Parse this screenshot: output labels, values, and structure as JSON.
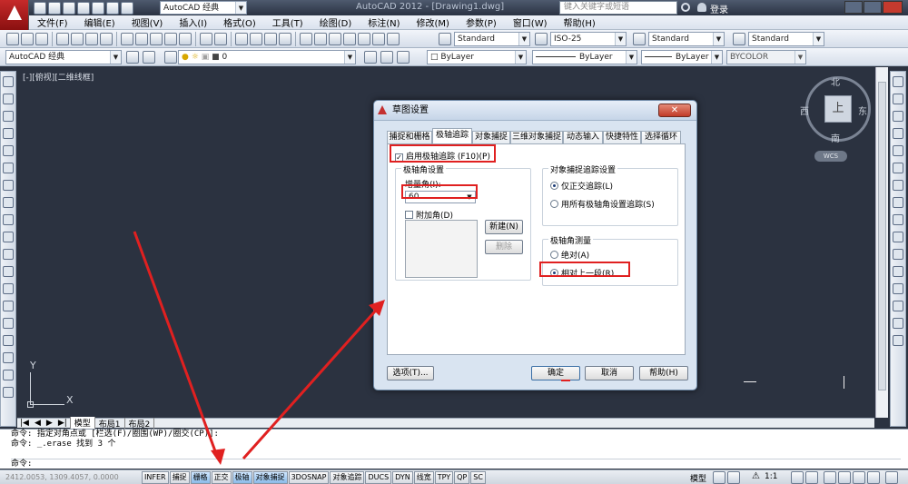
{
  "app": {
    "title": "AutoCAD 2012 - [Drawing1.dwg]",
    "workspace": "AutoCAD 经典",
    "search_placeholder": "键入关键字或短语",
    "login": "登录"
  },
  "menu": [
    "文件(F)",
    "编辑(E)",
    "视图(V)",
    "插入(I)",
    "格式(O)",
    "工具(T)",
    "绘图(D)",
    "标注(N)",
    "修改(M)",
    "参数(P)",
    "窗口(W)",
    "帮助(H)"
  ],
  "styles": {
    "text_style": "Standard",
    "dim_style": "ISO-25",
    "table_style": "Standard",
    "mleader_style": "Standard"
  },
  "layers": {
    "workspace": "AutoCAD 经典",
    "layer_name": "0",
    "color": "ByLayer",
    "linetype": "ByLayer",
    "lineweight": "ByLayer",
    "plotstyle": "BYCOLOR"
  },
  "viewport_label": "[-][俯视][二维线框]",
  "viewcube": {
    "north": "北",
    "south": "南",
    "east": "东",
    "west": "西",
    "top": "上",
    "wcs": "WCS"
  },
  "ucs": {
    "x": "X",
    "y": "Y"
  },
  "layout_tabs": [
    "模型",
    "布局1",
    "布局2"
  ],
  "command": {
    "line1": "命令: 指定对角点或 [栏选(F)/圈围(WP)/圈交(CP)]:",
    "line2": "命令: _.erase 找到 3 个",
    "prompt": "命令:"
  },
  "status": {
    "coords": "2412.0053, 1309.4057, 0.0000",
    "toggles": [
      "INFER",
      "捕捉",
      "栅格",
      "正交",
      "极轴",
      "对象捕捉",
      "3DOSNAP",
      "对象追踪",
      "DUCS",
      "DYN",
      "线宽",
      "TPY",
      "QP",
      "SC"
    ],
    "active": [
      "栅格",
      "极轴",
      "对象捕捉"
    ],
    "model": "模型",
    "scale": "1:1"
  },
  "dialog": {
    "title": "草图设置",
    "tabs": [
      "捕捉和栅格",
      "极轴追踪",
      "对象捕捉",
      "三维对象捕捉",
      "动态输入",
      "快捷特性",
      "选择循环"
    ],
    "active_tab": "极轴追踪",
    "enable_polar": "启用极轴追踪 (F10)(P)",
    "polar_group": "极轴角设置",
    "increment_label": "增量角(I):",
    "increment_value": "60",
    "additional_label": "附加角(D)",
    "new_button": "新建(N)",
    "delete_button": "删除",
    "snap_tracking_group": "对象捕捉追踪设置",
    "ortho_only": "仅正交追踪(L)",
    "all_polar": "用所有极轴角设置追踪(S)",
    "measure_group": "极轴角测量",
    "absolute": "绝对(A)",
    "relative": "相对上一段(R)",
    "options_button": "选项(T)...",
    "ok_button": "确定",
    "cancel_button": "取消",
    "help_button": "帮助(H)"
  },
  "colors": {
    "annotation": "#e02020",
    "canvas": "#2b3240"
  }
}
